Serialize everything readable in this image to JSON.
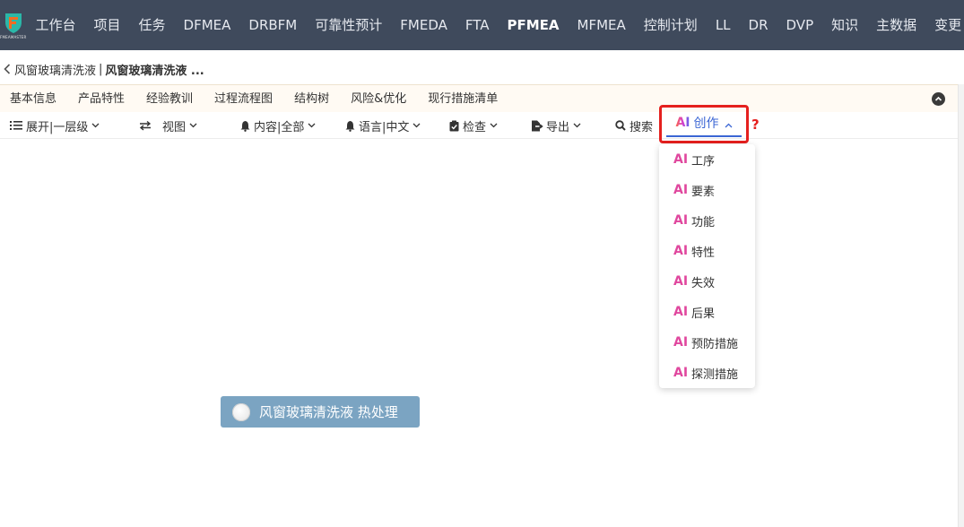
{
  "logo": {
    "brand_text": "FMEAMASTER"
  },
  "topnav": {
    "items": [
      {
        "label": "工作台",
        "active": false
      },
      {
        "label": "项目",
        "active": false
      },
      {
        "label": "任务",
        "active": false
      },
      {
        "label": "DFMEA",
        "active": false
      },
      {
        "label": "DRBFM",
        "active": false
      },
      {
        "label": "可靠性预计",
        "active": false
      },
      {
        "label": "FMEDA",
        "active": false
      },
      {
        "label": "FTA",
        "active": false
      },
      {
        "label": "PFMEA",
        "active": true
      },
      {
        "label": "MFMEA",
        "active": false
      },
      {
        "label": "控制计划",
        "active": false
      },
      {
        "label": "LL",
        "active": false
      },
      {
        "label": "DR",
        "active": false
      },
      {
        "label": "DVP",
        "active": false
      },
      {
        "label": "知识",
        "active": false
      },
      {
        "label": "主数据",
        "active": false
      },
      {
        "label": "变更",
        "active": false
      }
    ]
  },
  "breadcrumb": {
    "parent": "风窗玻璃清洗液",
    "separator": "|",
    "current": "风窗玻璃清洗液 ..."
  },
  "tabs": [
    {
      "label": "基本信息"
    },
    {
      "label": "产品特性"
    },
    {
      "label": "经验教训"
    },
    {
      "label": "过程流程图"
    },
    {
      "label": "结构树"
    },
    {
      "label": "风险&优化"
    },
    {
      "label": "现行措施清单"
    }
  ],
  "toolbar": {
    "expand_label": "展开|一层级",
    "view_label": "视图",
    "content_label": "内容|全部",
    "language_label": "语言|中文",
    "check_label": "检查",
    "export_label": "导出",
    "search_label": "搜索",
    "ai_badge": "AI",
    "create_label": "创作",
    "help_mark": "?"
  },
  "dropdown": {
    "ai_badge": "AI",
    "items": [
      {
        "label": "工序"
      },
      {
        "label": "要素"
      },
      {
        "label": "功能"
      },
      {
        "label": "特性"
      },
      {
        "label": "失效"
      },
      {
        "label": "后果"
      },
      {
        "label": "预防措施"
      },
      {
        "label": "探测措施"
      }
    ]
  },
  "canvas": {
    "node_label": "风窗玻璃清洗液 热处理"
  },
  "colors": {
    "topnav_bg": "#3f4a5c",
    "accent_blue": "#3b66d4",
    "highlight_red": "#e5201e",
    "ai_pink": "#e0479e",
    "node_bg": "#7ba4c2",
    "tabbar_bg": "#fffaf3"
  }
}
